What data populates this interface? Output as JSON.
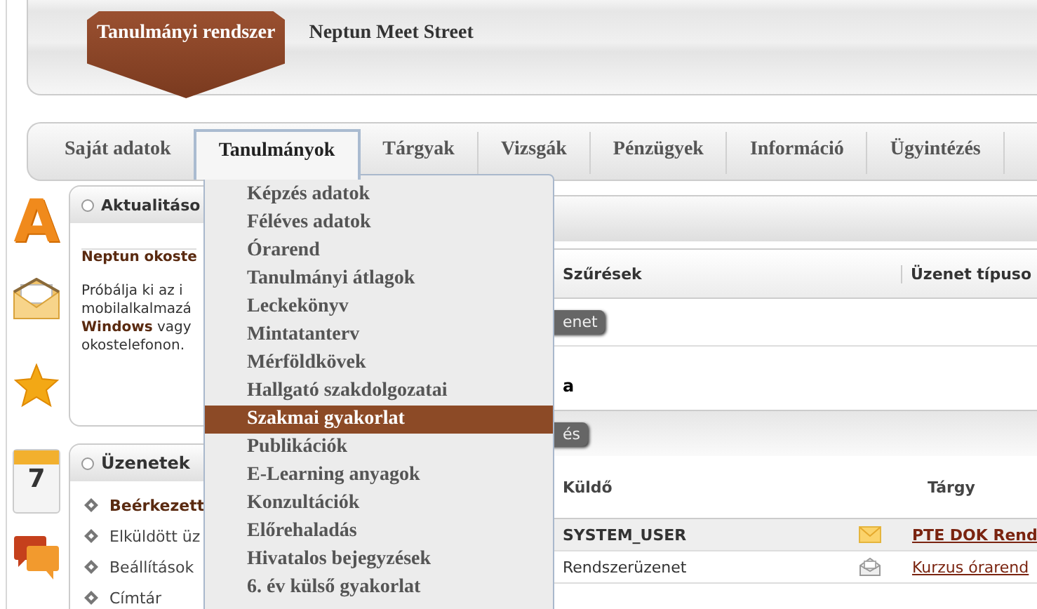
{
  "header": {
    "tabs": [
      {
        "label": "Tanulmányi rendszer",
        "selected": true
      },
      {
        "label": "Neptun Meet Street",
        "selected": false
      }
    ]
  },
  "nav": {
    "tabs": [
      {
        "label": "Saját adatok",
        "selected": false
      },
      {
        "label": "Tanulmányok",
        "selected": true
      },
      {
        "label": "Tárgyak",
        "selected": false
      },
      {
        "label": "Vizsgák",
        "selected": false
      },
      {
        "label": "Pénzügyek",
        "selected": false
      },
      {
        "label": "Információ",
        "selected": false
      },
      {
        "label": "Ügyintézés",
        "selected": false
      }
    ]
  },
  "menu": {
    "items": [
      {
        "label": "Képzés adatok",
        "selected": false
      },
      {
        "label": "Féléves adatok",
        "selected": false
      },
      {
        "label": "Órarend",
        "selected": false
      },
      {
        "label": "Tanulmányi átlagok",
        "selected": false
      },
      {
        "label": "Leckekönyv",
        "selected": false
      },
      {
        "label": "Mintatanterv",
        "selected": false
      },
      {
        "label": "Mérföldkövek",
        "selected": false
      },
      {
        "label": "Hallgató szakdolgozatai",
        "selected": false
      },
      {
        "label": "Szakmai gyakorlat",
        "selected": true
      },
      {
        "label": "Publikációk",
        "selected": false
      },
      {
        "label": "E-Learning anyagok",
        "selected": false
      },
      {
        "label": "Konzultációk",
        "selected": false
      },
      {
        "label": "Előrehaladás",
        "selected": false
      },
      {
        "label": "Hivatalos bejegyzések",
        "selected": false
      },
      {
        "label": "6. év külső gyakorlat",
        "selected": false
      }
    ]
  },
  "side_icons": [
    {
      "kind": "letter",
      "text": "A"
    },
    {
      "kind": "envelope"
    },
    {
      "kind": "star"
    },
    {
      "kind": "calendar",
      "text": "7"
    },
    {
      "kind": "chat"
    }
  ],
  "news_panel": {
    "title": "Aktualitáso",
    "headline": "Neptun okoste",
    "lines": [
      "Próbálja ki az i",
      "mobilalkalmazá",
      "**Windows** vagy",
      "okostelefonon."
    ]
  },
  "messages_panel": {
    "title": "Üzenetek",
    "items": [
      {
        "label": "Beérkezett",
        "selected": true
      },
      {
        "label": "Elküldött üz",
        "selected": false
      },
      {
        "label": "Beállítások",
        "selected": false
      },
      {
        "label": "Címtár",
        "selected": false
      }
    ]
  },
  "inbox": {
    "filter_columns": [
      "Szűrések",
      "Üzenet típuso"
    ],
    "filter_button": "enet",
    "filter_label": "a",
    "action_button": "és",
    "columns": [
      "Küldő",
      "Tárgy"
    ],
    "rows": [
      {
        "sender": "SYSTEM_USER",
        "read": false,
        "subject": "PTE DOK Rend"
      },
      {
        "sender": "Rendszerüzenet",
        "read": true,
        "subject": "Kurzus órarend"
      }
    ]
  }
}
